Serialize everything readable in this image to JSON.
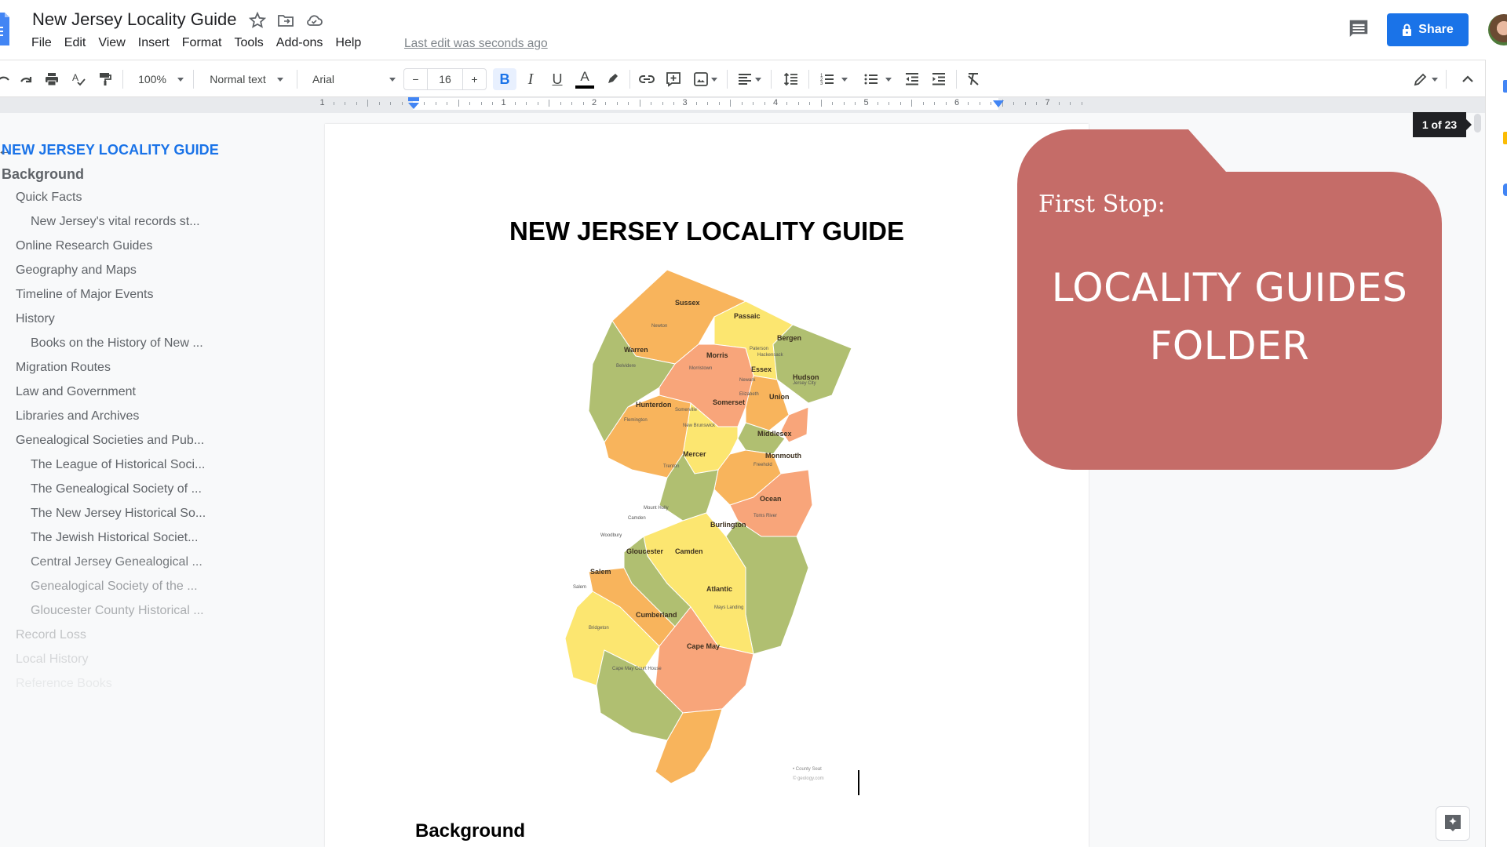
{
  "app": {
    "doc_title": "New Jersey Locality Guide",
    "last_edit": "Last edit was seconds ago",
    "share_label": "Share",
    "icons": [
      "docs-logo-icon",
      "star-icon",
      "move-to-folder-icon",
      "cloud-saved-icon",
      "comment-icon",
      "lock-icon"
    ]
  },
  "menu": [
    "File",
    "Edit",
    "View",
    "Insert",
    "Format",
    "Tools",
    "Add-ons",
    "Help"
  ],
  "toolbar": {
    "zoom": "100%",
    "style": "Normal text",
    "font": "Arial",
    "font_size": "16",
    "minus": "−",
    "plus": "+",
    "bold": "B",
    "italic": "I",
    "underline": "U",
    "text_color": "A",
    "text_color_value": "#000000"
  },
  "ruler": {
    "labels": [
      "1",
      "1",
      "2",
      "3",
      "4",
      "5",
      "6",
      "7"
    ]
  },
  "outline": {
    "back": "←",
    "items": [
      {
        "label": "NEW JERSEY LOCALITY GUIDE",
        "level": 0
      },
      {
        "label": "Background",
        "level": 1
      },
      {
        "label": "Quick Facts",
        "level": 2
      },
      {
        "label": "New Jersey's vital records st...",
        "level": 3
      },
      {
        "label": "Online Research Guides",
        "level": 2
      },
      {
        "label": "Geography and Maps",
        "level": 2
      },
      {
        "label": "Timeline of Major Events",
        "level": 2
      },
      {
        "label": "History",
        "level": 2
      },
      {
        "label": "Books on the History of New ...",
        "level": 3
      },
      {
        "label": "Migration Routes",
        "level": 2
      },
      {
        "label": "Law and Government",
        "level": 2
      },
      {
        "label": "Libraries and Archives",
        "level": 2
      },
      {
        "label": "Genealogical Societies and Pub...",
        "level": 2
      },
      {
        "label": "The League of Historical Soci...",
        "level": 3
      },
      {
        "label": "The Genealogical Society of ...",
        "level": 3
      },
      {
        "label": "The New Jersey Historical So...",
        "level": 3
      },
      {
        "label": "The Jewish Historical Societ...",
        "level": 3
      },
      {
        "label": "Central Jersey Genealogical ...",
        "level": 3
      },
      {
        "label": "Genealogical Society of the ...",
        "level": 3
      },
      {
        "label": "Gloucester County Historical ...",
        "level": 3
      },
      {
        "label": "Record Loss",
        "level": 2
      },
      {
        "label": "Local History",
        "level": 2
      },
      {
        "label": "Reference Books",
        "level": 2
      }
    ]
  },
  "document": {
    "heading": "NEW JERSEY LOCALITY GUIDE",
    "section_heading": "Background",
    "map": {
      "counties": [
        "Sussex",
        "Passaic",
        "Bergen",
        "Warren",
        "Morris",
        "Essex",
        "Hudson",
        "Union",
        "Somerset",
        "Hunterdon",
        "Middlesex",
        "Mercer",
        "Monmouth",
        "Ocean",
        "Burlington",
        "Camden",
        "Gloucester",
        "Salem",
        "Atlantic",
        "Cumberland",
        "Cape May"
      ],
      "seats": [
        "Newton",
        "Paterson",
        "Hackensack",
        "Belvidere",
        "Morristown",
        "Newark",
        "Jersey City",
        "Elizabeth",
        "Somerville",
        "Flemington",
        "New Brunswick",
        "Trenton",
        "Freehold",
        "Toms River",
        "Mount Holly",
        "Camden",
        "Woodbury",
        "Salem",
        "Mays Landing",
        "Bridgeton",
        "Cape May Court House"
      ],
      "legend": "• County Seat",
      "credit": "© geology.com"
    }
  },
  "overlay": {
    "subtitle": "First Stop:",
    "title_line1": "LOCALITY GUIDES",
    "title_line2": "FOLDER",
    "color": "#c56c68"
  },
  "page_counter": "1 of 23"
}
